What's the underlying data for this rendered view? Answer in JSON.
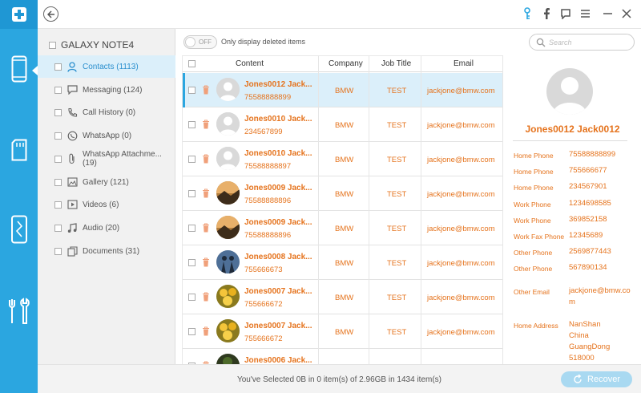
{
  "app": {
    "accent": "#2ba6e0",
    "orange": "#e5731d",
    "title": "dr.fone"
  },
  "rail": [
    {
      "name": "phone-icon",
      "active": true
    },
    {
      "name": "sd-card-icon",
      "active": false
    },
    {
      "name": "broken-phone-icon",
      "active": false
    },
    {
      "name": "tools-icon",
      "active": false
    }
  ],
  "sidebar": {
    "device": "GALAXY NOTE4",
    "items": [
      {
        "label": "Contacts (1113)",
        "icon": "person-icon"
      },
      {
        "label": "Messaging (124)",
        "icon": "message-icon"
      },
      {
        "label": "Call History (0)",
        "icon": "call-history-icon"
      },
      {
        "label": "WhatsApp (0)",
        "icon": "whatsapp-icon"
      },
      {
        "label": "WhatsApp Attachme... (19)",
        "icon": "attachment-icon"
      },
      {
        "label": "Gallery (121)",
        "icon": "gallery-icon"
      },
      {
        "label": "Videos (6)",
        "icon": "video-icon"
      },
      {
        "label": "Audio (20)",
        "icon": "audio-icon"
      },
      {
        "label": "Documents (31)",
        "icon": "documents-icon"
      }
    ]
  },
  "toolbar": {
    "toggle": "OFF",
    "label": "Only display deleted items",
    "search_placeholder": "Search"
  },
  "table": {
    "headers": {
      "content": "Content",
      "company": "Company",
      "job": "Job Title",
      "email": "Email"
    },
    "rows": [
      {
        "name": "Jones0012 Jack...",
        "phone": "75588888899",
        "company": "BMW",
        "job": "TEST",
        "email": "jackjone@bmw.com",
        "avatar": "default"
      },
      {
        "name": "Jones0010 Jack...",
        "phone": "234567899",
        "company": "BMW",
        "job": "TEST",
        "email": "jackjone@bmw.com",
        "avatar": "default"
      },
      {
        "name": "Jones0010 Jack...",
        "phone": "75588888897",
        "company": "BMW",
        "job": "TEST",
        "email": "jackjone@bmw.com",
        "avatar": "default"
      },
      {
        "name": "Jones0009 Jack...",
        "phone": "75588888896",
        "company": "BMW",
        "job": "TEST",
        "email": "jackjone@bmw.com",
        "avatar": "landscape"
      },
      {
        "name": "Jones0009 Jack...",
        "phone": "75588888896",
        "company": "BMW",
        "job": "TEST",
        "email": "jackjone@bmw.com",
        "avatar": "landscape"
      },
      {
        "name": "Jones0008 Jack...",
        "phone": "755666673",
        "company": "BMW",
        "job": "TEST",
        "email": "jackjone@bmw.com",
        "avatar": "people"
      },
      {
        "name": "Jones0007 Jack...",
        "phone": "755666672",
        "company": "BMW",
        "job": "TEST",
        "email": "jackjone@bmw.com",
        "avatar": "flowers"
      },
      {
        "name": "Jones0007 Jack...",
        "phone": "755666672",
        "company": "BMW",
        "job": "TEST",
        "email": "jackjone@bmw.com",
        "avatar": "flowers"
      },
      {
        "name": "Jones0006 Jack...",
        "phone": "",
        "company": "",
        "job": "",
        "email": "",
        "avatar": "dark"
      }
    ]
  },
  "detail": {
    "name": "Jones0012 Jack0012",
    "fields": [
      {
        "label": "Home Phone",
        "value": "75588888899"
      },
      {
        "label": "Home Phone",
        "value": "755666677"
      },
      {
        "label": "Home Phone",
        "value": "234567901"
      },
      {
        "label": "Work Phone",
        "value": "1234698585"
      },
      {
        "label": "Work Phone",
        "value": "369852158"
      },
      {
        "label": "Work Fax Phone",
        "value": "12345689"
      },
      {
        "label": "Other Phone",
        "value": "2569877443"
      },
      {
        "label": "Other Phone",
        "value": "567890134"
      }
    ],
    "email_label": "Other Email",
    "email_l1": "jackjone@bmw.co",
    "email_l2": "m",
    "addr_label": "Home Address",
    "addr": [
      "NanShan",
      "China",
      "GuangDong",
      "518000"
    ]
  },
  "bottom": {
    "status": "You've Selected 0B in 0 item(s) of 2.96GB in 1434 item(s)",
    "recover": "Recover"
  }
}
